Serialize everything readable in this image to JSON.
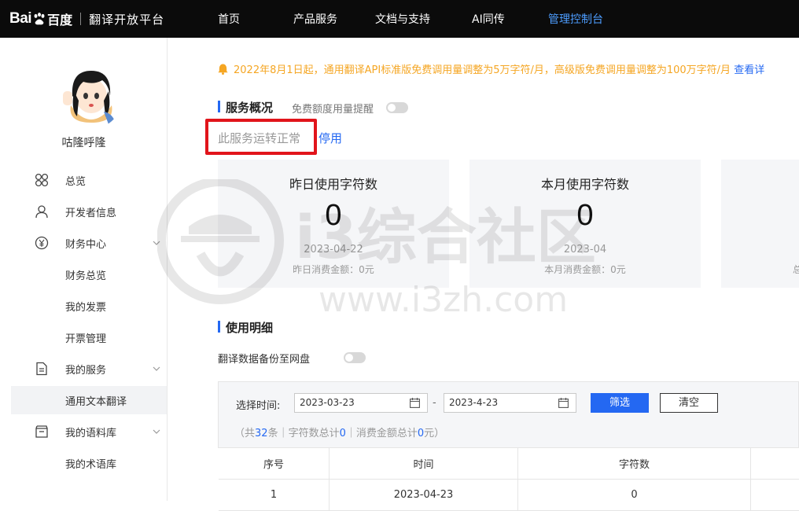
{
  "brand": {
    "logo_bai": "Bai",
    "logo_cn": "百度",
    "platform": "翻译开放平台"
  },
  "nav": {
    "items": [
      {
        "label": "首页"
      },
      {
        "label": "产品服务"
      },
      {
        "label": "文档与支持"
      },
      {
        "label": "AI同传"
      },
      {
        "label": "管理控制台",
        "active": true
      }
    ]
  },
  "sidebar": {
    "username": "咕隆呼隆",
    "items": [
      {
        "label": "总览",
        "icon": "grid-icon"
      },
      {
        "label": "开发者信息",
        "icon": "user-icon"
      },
      {
        "label": "财务中心",
        "icon": "yen-icon",
        "expandable": true
      },
      {
        "label": "财务总览",
        "sub": true
      },
      {
        "label": "我的发票",
        "sub": true
      },
      {
        "label": "开票管理",
        "sub": true
      },
      {
        "label": "我的服务",
        "icon": "document-icon",
        "expandable": true
      },
      {
        "label": "通用文本翻译",
        "sub": true,
        "selected": true
      },
      {
        "label": "我的语料库",
        "icon": "archive-icon",
        "expandable": true
      },
      {
        "label": "我的术语库",
        "sub": true
      }
    ]
  },
  "notice": {
    "text": "2022年8月1日起，通用翻译API标准版免费调用量调整为5万字符/月，高级版免费调用量调整为100万字符/月",
    "link": "查看详"
  },
  "overview": {
    "title": "服务概况",
    "toggle_label": "免费额度用量提醒",
    "status": "此服务运转正常",
    "stop": "停用",
    "cards": [
      {
        "title": "昨日使用字符数",
        "value": "0",
        "date": "2023-04-22",
        "amount_label": "昨日消费金额：0元"
      },
      {
        "title": "本月使用字符数",
        "value": "0",
        "date": "2023-04",
        "amount_label": "本月消费金额：0元"
      }
    ],
    "third_card_fragment": "总"
  },
  "details": {
    "title": "使用明细",
    "backup_label": "翻译数据备份至网盘",
    "filter": {
      "label": "选择时间:",
      "start_date": "2023-03-23",
      "end_date": "2023-4-23",
      "separator": "-",
      "filter_btn": "筛选",
      "clear_btn": "清空"
    },
    "summary": {
      "prefix": "（共",
      "count": "32",
      "mid1": "条｜字符数总计",
      "chars": "0",
      "mid2": "｜消费金额总计",
      "amount": "0",
      "suffix": "元）"
    },
    "table": {
      "headers": [
        "序号",
        "时间",
        "字符数"
      ],
      "rows": [
        [
          "1",
          "2023-04-23",
          "0"
        ]
      ]
    }
  },
  "watermark": {
    "cn": "i3综合社区",
    "url": "www.i3zh.com"
  },
  "colors": {
    "accent": "#2468f2",
    "notice": "#f5a623",
    "highlight_box": "#e1141b",
    "topbar": "#0b0b0b"
  }
}
